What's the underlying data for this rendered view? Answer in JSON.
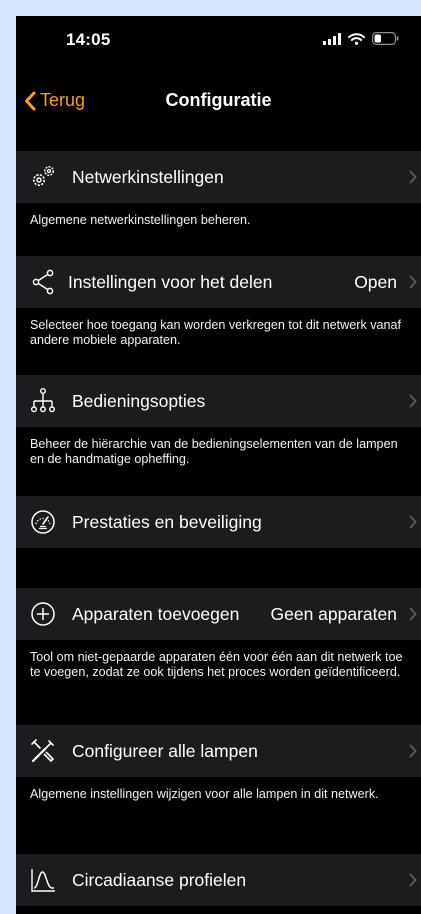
{
  "status": {
    "time": "14:05"
  },
  "nav": {
    "back_label": "Terug",
    "title": "Configuratie"
  },
  "colors": {
    "accent": "#ff9f0a",
    "row_bg": "#1c1c1e",
    "chevron": "#5a5a5e",
    "page_bg": "#000000",
    "frame_bg": "#d6e6fb"
  },
  "rows": [
    {
      "label": "Netwerkinstellingen",
      "icon": "gears-icon",
      "value": "",
      "description": "Algemene netwerkinstellingen beheren."
    },
    {
      "label": "Instellingen voor het delen",
      "icon": "share-icon",
      "value": "Open",
      "description": "Selecteer hoe toegang kan worden verkregen tot dit netwerk vanaf andere mobiele apparaten."
    },
    {
      "label": "Bedieningsopties",
      "icon": "hierarchy-icon",
      "value": "",
      "description": "Beheer de hiërarchie van de bedieningselementen van de lampen en de handmatige opheffing."
    },
    {
      "label": "Prestaties en beveiliging",
      "icon": "speedometer-icon",
      "value": "",
      "description": ""
    },
    {
      "label": "Apparaten toevoegen",
      "icon": "plus-circle-icon",
      "value": "Geen apparaten",
      "description": "Tool om niet-gepaarde apparaten één voor één aan dit netwerk toe te voegen, zodat ze ook tijdens het proces worden geïdentificeerd."
    },
    {
      "label": "Configureer alle lampen",
      "icon": "tools-icon",
      "value": "",
      "description": "Algemene instellingen wijzigen voor alle lampen in dit netwerk."
    },
    {
      "label": "Circadiaanse profielen",
      "icon": "curve-icon",
      "value": "",
      "description": ""
    }
  ]
}
